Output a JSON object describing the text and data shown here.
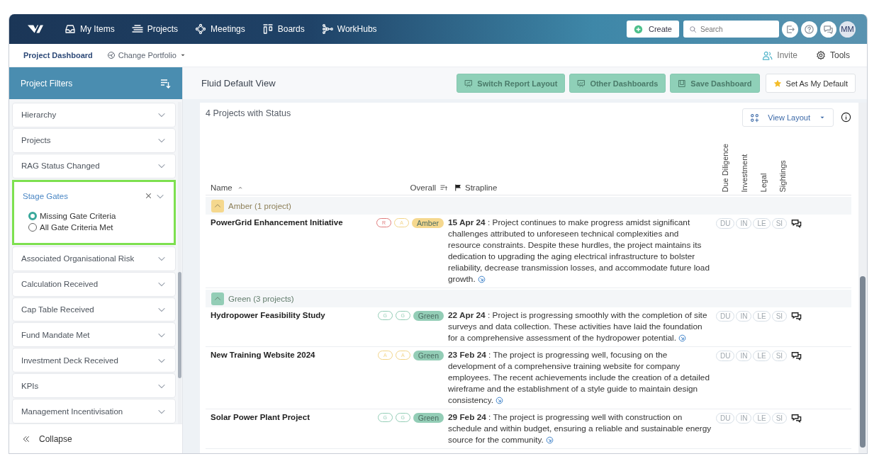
{
  "topnav": {
    "items": [
      {
        "label": "My Items"
      },
      {
        "label": "Projects"
      },
      {
        "label": "Meetings"
      },
      {
        "label": "Boards"
      },
      {
        "label": "WorkHubs"
      }
    ],
    "create": "Create",
    "search": {
      "placeholder": "Search"
    },
    "avatar": "MM"
  },
  "subnav": {
    "tabs": [
      {
        "label": "Project Dashboard",
        "selected": true,
        "kind": "tab"
      },
      {
        "label": "Change Portfolio",
        "selected": false,
        "kind": "dropdown"
      }
    ],
    "invite": "Invite",
    "tools": "Tools"
  },
  "sidebar": {
    "title": "Project Filters",
    "filters": [
      {
        "label": "Hierarchy",
        "active": false
      },
      {
        "label": "Projects",
        "active": false
      },
      {
        "label": "RAG Status Changed",
        "active": false
      },
      {
        "label": "Stage Gates",
        "active": true,
        "options": [
          {
            "label": "Missing Gate Criteria",
            "selected": true
          },
          {
            "label": "All Gate Criteria Met",
            "selected": false
          }
        ]
      },
      {
        "label": "Associated Organisational Risk",
        "active": false
      },
      {
        "label": "Calculation Received",
        "active": false
      },
      {
        "label": "Cap Table Received",
        "active": false
      },
      {
        "label": "Fund Mandate Met",
        "active": false
      },
      {
        "label": "Investment Deck Received",
        "active": false
      },
      {
        "label": "KPIs",
        "active": false
      },
      {
        "label": "Management Incentivisation",
        "active": false
      }
    ],
    "collapse": "Collapse"
  },
  "main": {
    "view_title": "Fluid Default View",
    "buttons": [
      {
        "label": "Switch Report Layout",
        "kind": "primary"
      },
      {
        "label": "Other Dashboards",
        "kind": "primary"
      },
      {
        "label": "Save Dashboard",
        "kind": "primary"
      },
      {
        "label": "Set As My Default",
        "kind": "secondary"
      }
    ],
    "heading": "4 Projects with Status",
    "view_layout": "View Layout",
    "columns": {
      "name": "Name",
      "overall": "Overall",
      "strapline": "Strapline",
      "gates": [
        "Due Diligence",
        "Investment",
        "Legal",
        "Sightings"
      ]
    },
    "groups": [
      {
        "label": "Amber (1 project)",
        "color": "#f5d88e",
        "expanded": true,
        "rows": [
          {
            "name": "PowerGrid Enhancement Initiative",
            "badges": [
              {
                "text": "R",
                "color": "#e07b7b"
              },
              {
                "text": "A",
                "color": "#f2d58a"
              }
            ],
            "overall": {
              "text": "Amber",
              "color": "#f5d88e"
            },
            "strapline": "**15 Apr 24** : Project continues to make progress amidst significant challenges attributed to unforeseen technical complexities and resource constraints. Despite these hurdles, the project maintains its dedication to upgrading the aging electrical infrastructure to bolster reliability, decrease transmission losses, and accommodate future load growth.",
            "gates": [
              "DU",
              "IN",
              "LE",
              "SI"
            ]
          }
        ]
      },
      {
        "label": "Green (3 projects)",
        "color": "#93cdb6",
        "expanded": true,
        "rows": [
          {
            "name": "Hydropower Feasibility Study",
            "badges": [
              {
                "text": "G",
                "color": "#93cdb6"
              },
              {
                "text": "G",
                "color": "#93cdb6"
              }
            ],
            "overall": {
              "text": "Green",
              "color": "#93cdb6"
            },
            "strapline": "**22 Apr 24** : Project is progressing smoothly with the completion of site surveys and data collection. These activities have laid the foundation for a comprehensive assessment of the hydropower potential.",
            "gates": [
              "DU",
              "IN",
              "LE",
              "SI"
            ]
          },
          {
            "name": "New Training Website 2024",
            "badges": [
              {
                "text": "A",
                "color": "#f2d58a"
              },
              {
                "text": "A",
                "color": "#f2d58a"
              }
            ],
            "overall": {
              "text": "Green",
              "color": "#93cdb6"
            },
            "strapline": "**23 Feb 24** : The project is progressing well, focusing on the development of a comprehensive training website for company employees. The recent achievements include the creation of a detailed wireframe and the establishment of a style guide to maintain design consistency.",
            "gates": [
              "DU",
              "IN",
              "LE",
              "SI"
            ]
          },
          {
            "name": "Solar Power Plant Project",
            "badges": [
              {
                "text": "G",
                "color": "#93cdb6"
              },
              {
                "text": "G",
                "color": "#93cdb6"
              }
            ],
            "overall": {
              "text": "Green",
              "color": "#93cdb6"
            },
            "strapline": "**29 Feb 24** : The project is progressing well with construction on schedule and within budget, ensuring a reliable and sustainable energy source for the community.",
            "gates": [
              "DU",
              "IN",
              "LE",
              "SI"
            ]
          }
        ]
      }
    ]
  }
}
